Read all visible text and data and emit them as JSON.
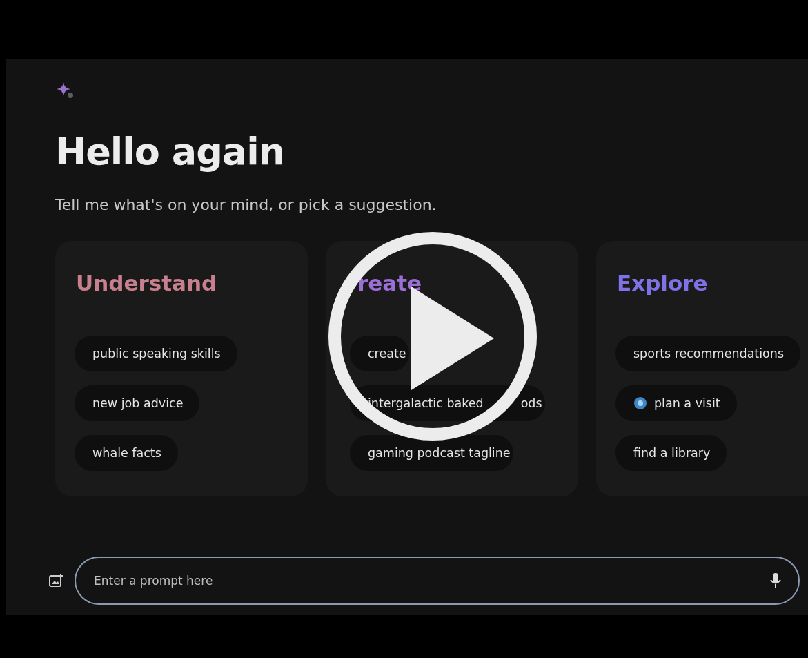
{
  "greeting": {
    "title": "Hello again",
    "subtitle": "Tell me what's on your mind, or pick a suggestion."
  },
  "cards": [
    {
      "title": "Understand",
      "color": "#c9808e",
      "chips": [
        {
          "label": "public speaking skills",
          "kind": "plain"
        },
        {
          "label": "new job advice",
          "kind": "plain"
        },
        {
          "label": "whale facts",
          "kind": "plain"
        }
      ]
    },
    {
      "title": "reate",
      "color": "#9c6fd6",
      "chips": [
        {
          "label": "create",
          "kind": "plain"
        },
        {
          "label": "intergalactic baked",
          "label_tail": "ods",
          "kind": "plain"
        },
        {
          "label": "gaming podcast tagline",
          "kind": "plain"
        }
      ]
    },
    {
      "title": "Explore",
      "color": "#7f72e6",
      "chips": [
        {
          "label": "sports recommendations",
          "kind": "plain"
        },
        {
          "label": "plan a visit",
          "kind": "icon"
        },
        {
          "label": "find a library",
          "kind": "plain"
        }
      ]
    }
  ],
  "prompt": {
    "placeholder": "Enter a prompt here"
  },
  "player": {
    "play_button": true
  }
}
